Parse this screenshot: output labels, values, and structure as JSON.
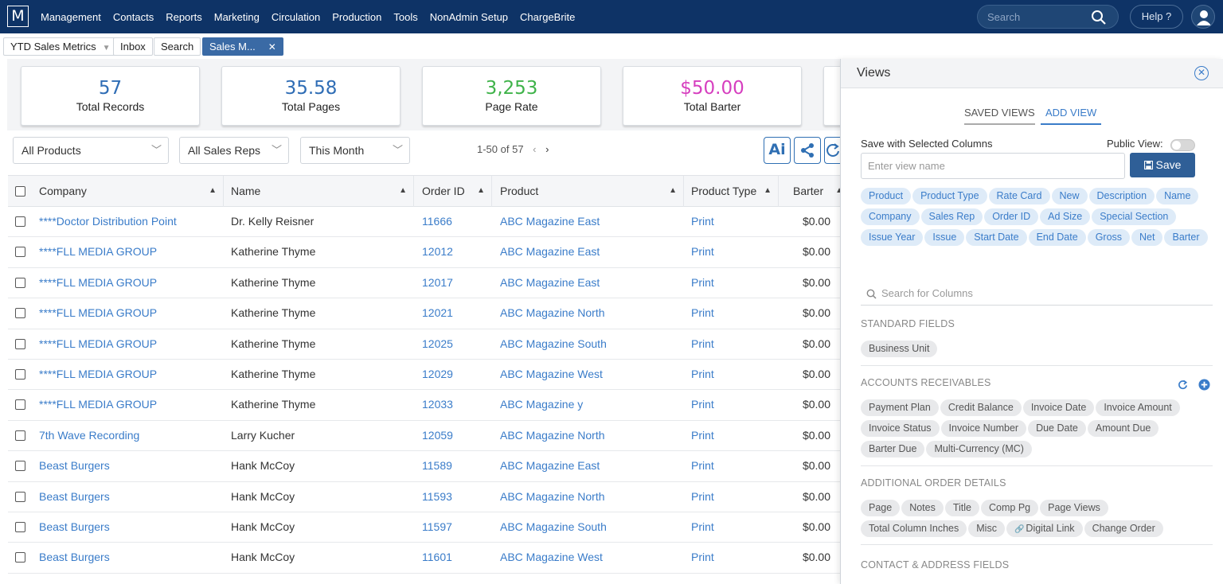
{
  "nav": {
    "logo": "M",
    "items": [
      "Management",
      "Contacts",
      "Reports",
      "Marketing",
      "Circulation",
      "Production",
      "Tools",
      "NonAdmin Setup",
      "ChargeBrite"
    ],
    "search_placeholder": "Search",
    "help": "Help ?"
  },
  "tabs": {
    "dropdown": "YTD Sales Metrics",
    "inbox": "Inbox",
    "search": "Search",
    "active": "Sales M..."
  },
  "metrics": [
    {
      "value": "57",
      "label": "Total Records",
      "color": "#2f6db5"
    },
    {
      "value": "35.58",
      "label": "Total Pages",
      "color": "#2f6db5"
    },
    {
      "value": "3,253",
      "label": "Page Rate",
      "color": "#3fb34a"
    },
    {
      "value": "$50.00",
      "label": "Total Barter",
      "color": "#d63fbf"
    }
  ],
  "filters": {
    "products": "All Products",
    "sales_reps": "All Sales Reps",
    "period": "This Month",
    "pager": "1-50 of 57",
    "ai_label": "Ai"
  },
  "table": {
    "headers": [
      "Company",
      "Name",
      "Order ID",
      "Product",
      "Product Type",
      "Barter"
    ],
    "rows": [
      [
        "****Doctor Distribution Point",
        "Dr. Kelly Reisner",
        "11666",
        "ABC Magazine East",
        "Print",
        "$0.00"
      ],
      [
        "****FLL MEDIA GROUP",
        "Katherine Thyme",
        "12012",
        "ABC Magazine East",
        "Print",
        "$0.00"
      ],
      [
        "****FLL MEDIA GROUP",
        "Katherine Thyme",
        "12017",
        "ABC Magazine East",
        "Print",
        "$0.00"
      ],
      [
        "****FLL MEDIA GROUP",
        "Katherine Thyme",
        "12021",
        "ABC Magazine North",
        "Print",
        "$0.00"
      ],
      [
        "****FLL MEDIA GROUP",
        "Katherine Thyme",
        "12025",
        "ABC Magazine South",
        "Print",
        "$0.00"
      ],
      [
        "****FLL MEDIA GROUP",
        "Katherine Thyme",
        "12029",
        "ABC Magazine West",
        "Print",
        "$0.00"
      ],
      [
        "****FLL MEDIA GROUP",
        "Katherine Thyme",
        "12033",
        "ABC Magazine y",
        "Print",
        "$0.00"
      ],
      [
        "7th Wave Recording",
        "Larry Kucher",
        "12059",
        "ABC Magazine North",
        "Print",
        "$0.00"
      ],
      [
        "Beast Burgers",
        "Hank McCoy",
        "11589",
        "ABC Magazine East",
        "Print",
        "$0.00"
      ],
      [
        "Beast Burgers",
        "Hank McCoy",
        "11593",
        "ABC Magazine North",
        "Print",
        "$0.00"
      ],
      [
        "Beast Burgers",
        "Hank McCoy",
        "11597",
        "ABC Magazine South",
        "Print",
        "$0.00"
      ],
      [
        "Beast Burgers",
        "Hank McCoy",
        "11601",
        "ABC Magazine West",
        "Print",
        "$0.00"
      ]
    ]
  },
  "panel": {
    "title": "Views",
    "tab_saved": "SAVED VIEWS",
    "tab_add": "ADD VIEW",
    "save_with_label": "Save with Selected Columns",
    "public_label": "Public View:",
    "name_placeholder": "Enter view name",
    "save_label": "Save",
    "selected_columns": [
      "Product",
      "Product Type",
      "Rate Card",
      "New",
      "Description",
      "Name",
      "Company",
      "Sales Rep",
      "Order ID",
      "Ad Size",
      "Special Section",
      "Issue Year",
      "Issue",
      "Start Date",
      "End Date",
      "Gross",
      "Net",
      "Barter"
    ],
    "search_placeholder": "Search for Columns",
    "sections": [
      {
        "title": "STANDARD FIELDS",
        "fields": [
          "Business Unit"
        ]
      },
      {
        "title": "ACCOUNTS RECEIVABLES",
        "fields": [
          "Payment Plan",
          "Credit Balance",
          "Invoice Date",
          "Invoice Amount",
          "Invoice Status",
          "Invoice Number",
          "Due Date",
          "Amount Due",
          "Barter Due",
          "Multi-Currency (MC)"
        ]
      },
      {
        "title": "ADDITIONAL ORDER DETAILS",
        "fields": [
          "Page",
          "Notes",
          "Title",
          "Comp Pg",
          "Page Views",
          "Total Column Inches",
          "Misc",
          "Digital Link",
          "Change Order"
        ]
      },
      {
        "title": "CONTACT & ADDRESS FIELDS",
        "fields": []
      }
    ]
  }
}
